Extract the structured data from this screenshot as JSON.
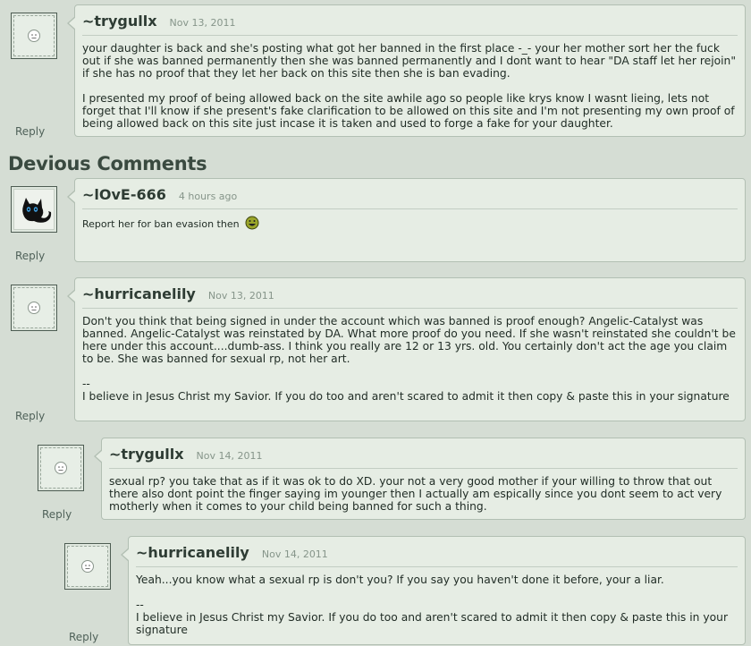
{
  "section_title": "Devious Comments",
  "reply_label": "Reply",
  "comments": [
    {
      "author": "~trygullx",
      "date": "Nov 13, 2011",
      "avatar": "blank-face",
      "paragraphs": [
        "your daughter is back and she's posting what got her banned in the first place -_- your her mother sort her the fuck out if she was banned permanently then she was banned permanently and I dont want to hear \"DA staff let her rejoin\" if she has no proof that they let her back on this site then she is ban evading.",
        "I presented my proof of being allowed back on the site awhile ago so people like krys know I wasnt lieing, lets not forget that I'll know if she present's fake clarification to be allowed on this site and I'm not presenting my own proof of being allowed back on this site just incase it is taken and used to forge a fake for your daughter."
      ]
    },
    {
      "author": "~lOvE-666",
      "date": "4 hours ago",
      "avatar": "black-cat",
      "paragraphs": [
        "Report her for ban evasion then"
      ],
      "emoticon": "grin-emoticon"
    },
    {
      "author": "~hurricanelily",
      "date": "Nov 13, 2011",
      "avatar": "blank-face",
      "paragraphs": [
        "Don't you think that being signed in under the account which was banned is proof enough? Angelic-Catalyst was banned. Angelic-Catalyst was reinstated by DA. What more proof do you need. If she wasn't reinstated she couldn't be here under this account....dumb-ass. I think you really are 12 or 13 yrs. old. You certainly don't act the age you claim to be. She was banned for sexual rp, not her art.",
        "--",
        "I believe in Jesus Christ my Savior. If you do too and aren't scared to admit it then copy & paste this in your signature"
      ]
    },
    {
      "author": "~trygullx",
      "date": "Nov 14, 2011",
      "avatar": "blank-face",
      "paragraphs": [
        "sexual rp? you take that as if it was ok to do XD. your not a very good mother if your willing to throw that out there also dont point the finger saying im younger then I actually am espically since you dont seem to act very motherly when it comes to your child being banned for such a thing."
      ]
    },
    {
      "author": "~hurricanelily",
      "date": "Nov 14, 2011",
      "avatar": "blank-face",
      "paragraphs": [
        "Yeah...you know what a sexual rp is don't you? If you say you haven't done it before, your a liar.",
        "--",
        "I believe in Jesus Christ my Savior. If you do too and aren't scared to admit it then copy & paste this in your signature"
      ]
    }
  ]
}
